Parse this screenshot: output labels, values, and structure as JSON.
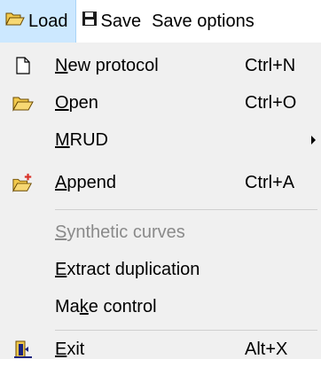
{
  "menubar": {
    "load": "Load",
    "save": "Save",
    "save_options": "Save options"
  },
  "menu": {
    "new_protocol": {
      "label": "New protocol",
      "shortcut": "Ctrl+N",
      "icon": "new-document-icon"
    },
    "open": {
      "label": "Open",
      "shortcut": "Ctrl+O",
      "icon": "open-folder-icon"
    },
    "mrud": {
      "label": "MRUD"
    },
    "append": {
      "label": "Append",
      "shortcut": "Ctrl+A",
      "icon": "append-folder-icon"
    },
    "synthetic_curves": {
      "label": "Synthetic curves",
      "disabled": true
    },
    "extract_duplication": {
      "label": "Extract duplication"
    },
    "make_control": {
      "label": "Make control"
    },
    "exit": {
      "label": "Exit",
      "shortcut": "Alt+X",
      "icon": "exit-icon"
    }
  },
  "colors": {
    "menubar_active": "#cce8ff",
    "menu_bg": "#f0f0f0",
    "folder_yellow": "#f2c94c",
    "disabled_text": "#8a8a8a",
    "accent_red": "#d9342b"
  }
}
